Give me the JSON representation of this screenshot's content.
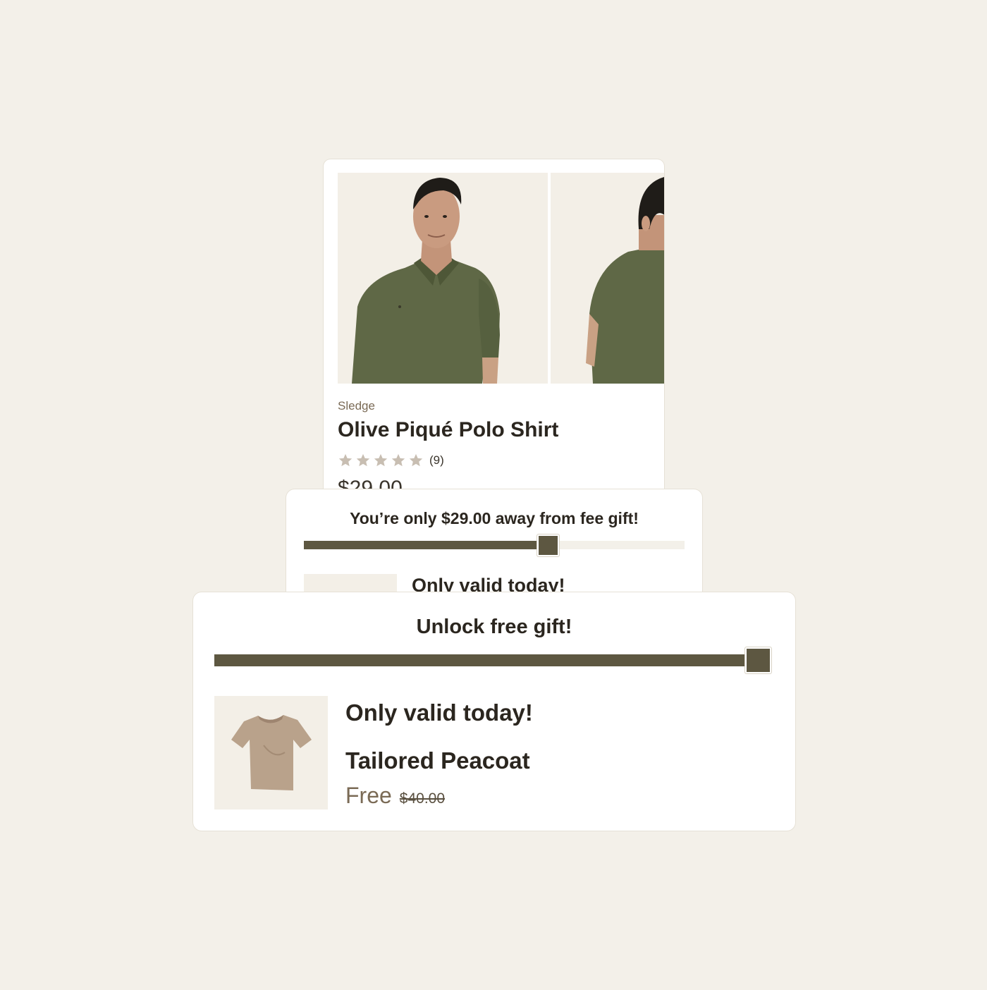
{
  "product": {
    "brand": "Sledge",
    "title": "Olive Piqué Polo Shirt",
    "rating_stars": 5,
    "review_count": "(9)",
    "price": "$29.00",
    "images": [
      "front-view-photo",
      "back-view-photo"
    ]
  },
  "progress_card": {
    "title": "You’re only $29.00 away from fee gift!",
    "progress": 0.64,
    "offer_text": "Only valid today!"
  },
  "gift_card": {
    "title": "Unlock free gift!",
    "progress": 1.0,
    "offer_text": "Only valid today!",
    "gift_name": "Tailored Peacoat",
    "gift_price": "Free",
    "original_price": "$40.00"
  },
  "colors": {
    "background": "#f3f0e9",
    "accent": "#5d5741",
    "text": "#2b261f",
    "muted": "#7a6a55",
    "olive_shirt": "#5f6846"
  }
}
